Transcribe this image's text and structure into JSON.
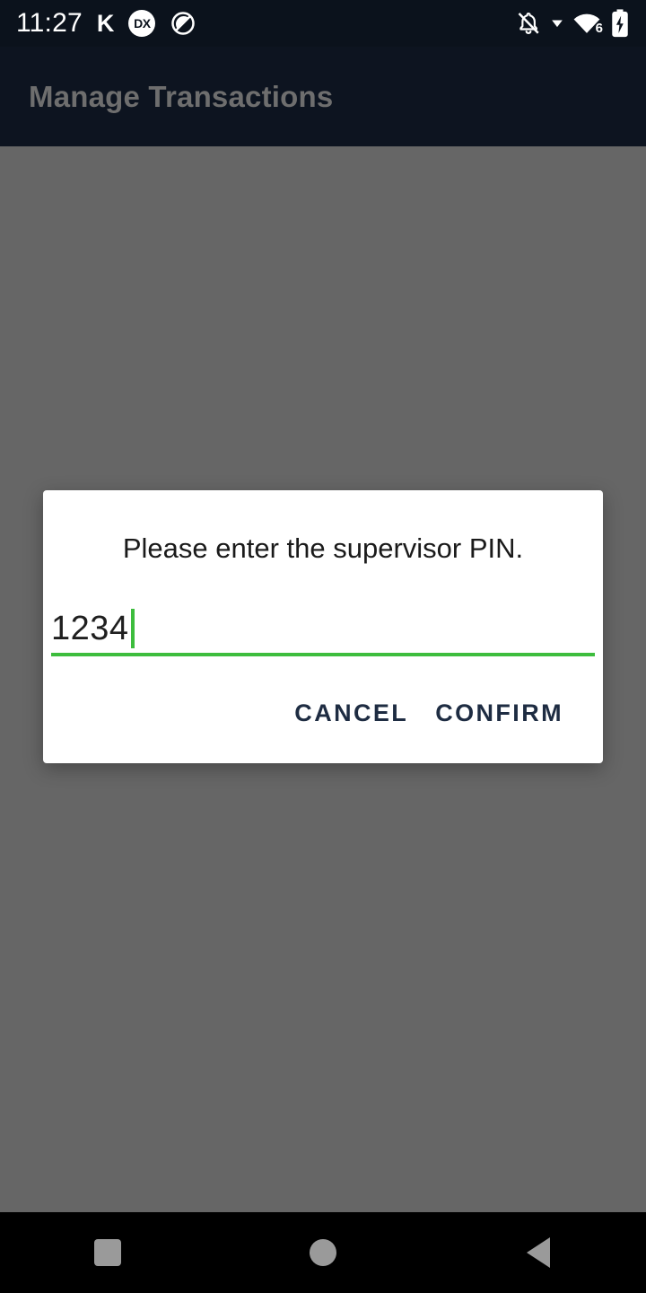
{
  "status_bar": {
    "time": "11:27",
    "left_icons": [
      {
        "name": "k-app-icon",
        "label": "K"
      },
      {
        "name": "dx-app-badge-icon",
        "label": "DX"
      },
      {
        "name": "do-not-disturb-icon",
        "label": ""
      }
    ],
    "right_icons": [
      {
        "name": "notifications-silenced-icon",
        "label": ""
      },
      {
        "name": "dropdown-triangle-icon",
        "label": ""
      },
      {
        "name": "wifi-icon",
        "label": "6"
      },
      {
        "name": "battery-charging-icon",
        "label": ""
      }
    ]
  },
  "app_bar": {
    "title": "Manage Transactions"
  },
  "dialog": {
    "title": "Please enter the supervisor PIN.",
    "pin_input": {
      "value": "1234",
      "placeholder": ""
    },
    "cancel_label": "CANCEL",
    "confirm_label": "CONFIRM"
  },
  "nav_bar": {
    "recents_label": "recents-square-icon",
    "home_label": "home-circle-icon",
    "back_label": "back-triangle-icon"
  },
  "colors": {
    "app_bar_bg": "#0d1420",
    "status_bar_bg": "#0b121c",
    "scrim": "#666666",
    "accent_green": "#3dbd3d",
    "button_text": "#1e2c42",
    "dialog_bg": "#ffffff",
    "nav_bar_bg": "#000000"
  }
}
